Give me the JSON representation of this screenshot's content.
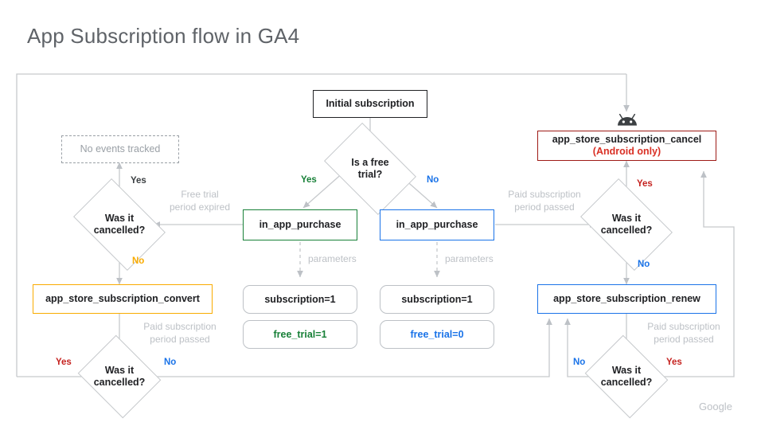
{
  "page": {
    "title": "App Subscription flow in GA4",
    "watermark": "Google"
  },
  "colors": {
    "green": "#188038",
    "blue": "#1a73e8",
    "red": "#c5221f",
    "red_border": "#9e1b16",
    "red_text": "#d93025",
    "amber": "#f9ab00",
    "grey_text": "#bdc1c6",
    "dark_text": "#202124",
    "line": "#bdc1c6",
    "title_grey": "#5f6368"
  },
  "nodes": {
    "initial_subscription": {
      "label": "Initial subscription",
      "style": "black-border"
    },
    "is_free_trial": {
      "line1": "Is a free",
      "line2": "trial?",
      "style": "diamond"
    },
    "no_events_tracked": {
      "label": "No events tracked",
      "style": "dashed-grey"
    },
    "was_it_cancelled_left": {
      "line1": "Was it",
      "line2": "cancelled?",
      "style": "diamond"
    },
    "app_store_subscription_convert": {
      "label": "app_store_subscription_convert",
      "style": "amber-border"
    },
    "was_it_cancelled_bottom_left": {
      "line1": "Was it",
      "line2": "cancelled?",
      "style": "diamond"
    },
    "in_app_purchase_free": {
      "label": "in_app_purchase",
      "style": "green-border"
    },
    "in_app_purchase_paid": {
      "label": "in_app_purchase",
      "style": "blue-border"
    },
    "subscription_free": {
      "label": "subscription=1",
      "style": "param"
    },
    "free_trial_1": {
      "label": "free_trial=1",
      "style": "param-green"
    },
    "subscription_paid": {
      "label": "subscription=1",
      "style": "param"
    },
    "free_trial_0": {
      "label": "free_trial=0",
      "style": "param-blue"
    },
    "app_store_subscription_cancel": {
      "line1": "app_store_subscription_cancel",
      "line2": "(Android only)",
      "style": "red-border"
    },
    "was_it_cancelled_right": {
      "line1": "Was it",
      "line2": "cancelled?",
      "style": "diamond"
    },
    "app_store_subscription_renew": {
      "label": "app_store_subscription_renew",
      "style": "blue-border"
    },
    "was_it_cancelled_bottom_right": {
      "line1": "Was it",
      "line2": "cancelled?",
      "style": "diamond"
    }
  },
  "edge_labels": {
    "free_trial_yes": "Yes",
    "free_trial_no": "No",
    "left_cancelled_yes": "Yes",
    "left_cancelled_no": "No",
    "free_trial_period_expired_l1": "Free trial",
    "free_trial_period_expired_l2": "period expired",
    "parameters_left": "parameters",
    "parameters_right": "parameters",
    "paid_period_passed_left_l1": "Paid subscription",
    "paid_period_passed_left_l2": "period passed",
    "paid_period_passed_mid_l1": "Paid subscription",
    "paid_period_passed_mid_l2": "period passed",
    "paid_period_passed_right_l1": "Paid subscription",
    "paid_period_passed_right_l2": "period passed",
    "bottom_left_yes": "Yes",
    "bottom_left_no": "No",
    "right_cancelled_yes": "Yes",
    "right_cancelled_no": "No",
    "bottom_right_no": "No",
    "bottom_right_yes": "Yes"
  },
  "icons": {
    "android": "android-robot-icon"
  }
}
